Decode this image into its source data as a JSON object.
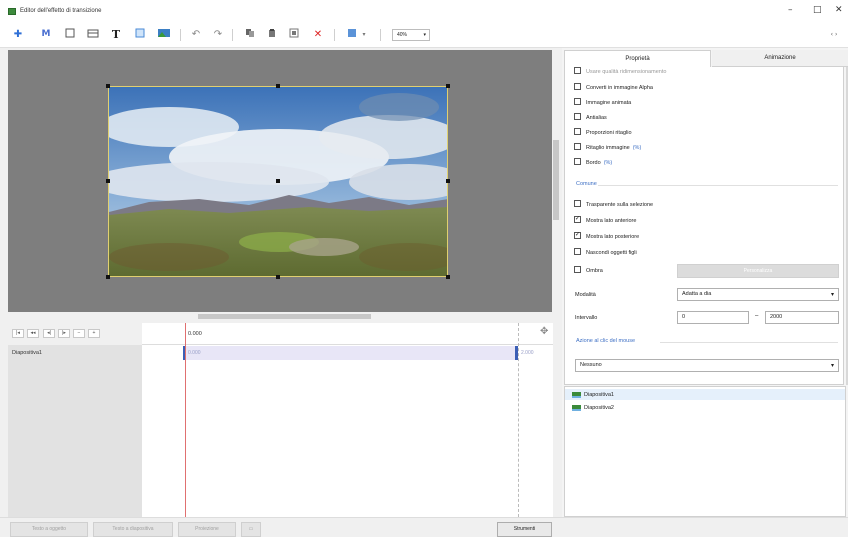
{
  "window": {
    "title": "Editor dell'effetto di transizione",
    "controls": {
      "minimize": "–",
      "maximize": "□",
      "close": "✕"
    }
  },
  "toolbar": {
    "zoom_value": "40%",
    "items": [
      "add-image-icon",
      "mask-icon",
      "frame-icon",
      "video-icon",
      "text-icon",
      "rectangle-icon",
      "image-icon",
      "undo-icon",
      "redo-icon",
      "copy-icon",
      "paste-icon",
      "duplicate-icon",
      "delete-icon",
      "grid-icon"
    ],
    "accent_color": "#2f6fd6",
    "delete_color": "#d22"
  },
  "timeline": {
    "ruler_start": "0.000",
    "row_label": "Diapositiva1",
    "marker_start": "0.000",
    "marker_end": "2.000"
  },
  "bottom": {
    "btn1": "Testo a oggetto",
    "btn2": "Testo a diapositiva",
    "btn3": "Proiezione",
    "strumenti": "Strumenti"
  },
  "panel": {
    "tab_props": "Proprietà",
    "tab_anim": "Animazione",
    "checkboxes_top": [
      {
        "label": "Usare qualità ridimensionamento",
        "checked": false
      },
      {
        "label": "Converti in immagine Alpha",
        "checked": false
      },
      {
        "label": "Immagine animata",
        "checked": false
      },
      {
        "label": "Antialias",
        "checked": false
      },
      {
        "label": "Proporzioni ritaglio",
        "checked": false
      },
      {
        "label": "Ritaglio immagine",
        "extra": "(%)",
        "checked": false
      },
      {
        "label": "Bordo",
        "extra": "(%)",
        "checked": false
      }
    ],
    "section_comune": "Comune",
    "checkboxes_comune": [
      {
        "label": "Trasparente sulla selezione",
        "checked": false
      },
      {
        "label": "Mostra lato anteriore",
        "checked": true
      },
      {
        "label": "Mostra lato posteriore",
        "checked": true
      },
      {
        "label": "Nascondi oggetti figli",
        "checked": false
      },
      {
        "label": "Ombra",
        "checked": false
      }
    ],
    "ombra_button": "Personalizza",
    "modalita_label": "Modalità",
    "modalita_value": "Adatta a dia",
    "intervallo_label": "Intervallo",
    "intervallo_from": "0",
    "intervallo_sep": "–",
    "intervallo_to": "2000",
    "section_mouse": "Azione al clic del mouse",
    "mouse_value": "Nessuno"
  },
  "objects": [
    "Diapositiva1",
    "Diapositiva2"
  ]
}
